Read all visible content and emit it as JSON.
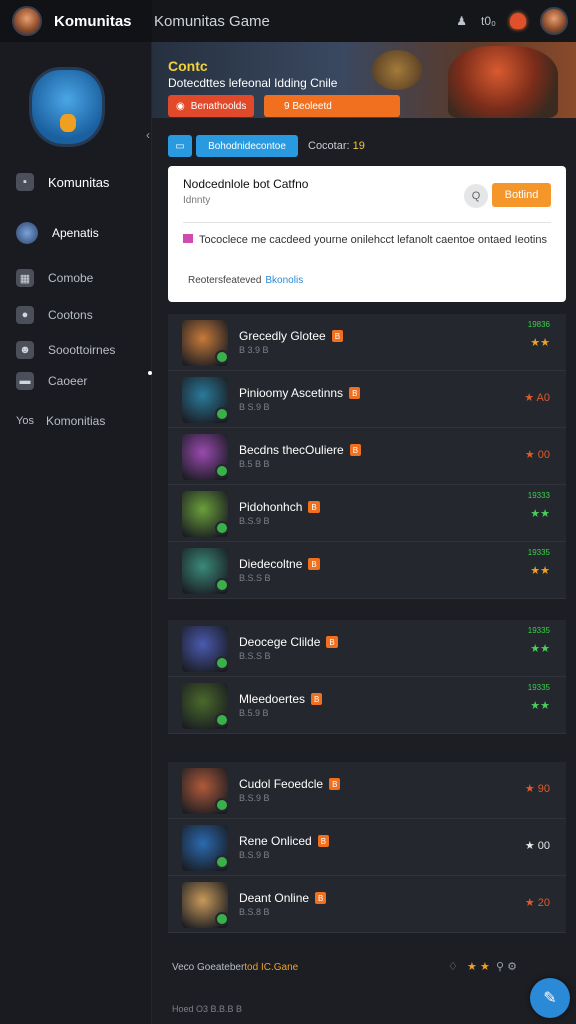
{
  "sidebar": {
    "brand": "Komunitas",
    "items": [
      {
        "label": "Komunitas",
        "icon": "square-icon"
      },
      {
        "label": "Apenatis",
        "icon": "avatar"
      },
      {
        "label": "Comobe",
        "icon": "grid-icon"
      },
      {
        "label": "Cootons",
        "icon": "gamepad-icon"
      },
      {
        "label": "Sooottoirnes",
        "icon": "people-icon"
      },
      {
        "label": "Caoeer",
        "icon": "chat-icon"
      },
      {
        "label": "Komonitias",
        "prefix": "Yos"
      }
    ]
  },
  "header": {
    "title": "Komunitas Game",
    "counter": "t0₀",
    "icon_left": "♟"
  },
  "banner": {
    "title": "Contc",
    "subtitle": "Dotecdttes lefeonal Idding Cnile",
    "button1": "Benathoolds",
    "button2": "9 Beoleetd"
  },
  "chips": {
    "icon_tab": "▭",
    "tab": "Bohodnidecontoe",
    "count_label": "Cocotar:",
    "count_value": "19"
  },
  "post": {
    "title": "Nodcednlole bot Catfno",
    "subtitle": "Idnnty",
    "game_btn": "Q",
    "action_btn": "Botlind",
    "message": "Tococlece me cacdeed yourne onilehcct lefanolt caentoe ontaed Ieotins",
    "footer": "Reotersfeateved",
    "footer_link": "Bkonolis"
  },
  "games": [
    {
      "name": "Grecedly Glotee",
      "badge": "B",
      "sub": "B 3.9 B",
      "count": "19836",
      "rating": "★★",
      "rating_style": "o",
      "thumb": "#c87a3a"
    },
    {
      "name": "Pinioomy Ascetinns",
      "badge": "B",
      "sub": "B S.9 B",
      "count": "",
      "rating": "★ A0",
      "rating_style": "r",
      "thumb": "#2a7a9a"
    },
    {
      "name": "Becdns thecOuliere",
      "badge": "B",
      "sub": "B.5 B B",
      "count": "",
      "rating": "★ 00",
      "rating_style": "r",
      "thumb": "#9a4ab0"
    },
    {
      "name": "Pidohonhch",
      "badge": "B",
      "sub": "B.S.9 B",
      "count": "19333",
      "rating": "★★",
      "rating_style": "g",
      "thumb": "#6aa03a"
    },
    {
      "name": "Diedecoltne",
      "badge": "B",
      "sub": "B.S.S B",
      "count": "19335",
      "rating": "★★",
      "rating_style": "o",
      "thumb": "#3a8a7a"
    },
    {
      "name": "Deocege Clilde",
      "badge": "B",
      "sub": "B.S.S B",
      "count": "19335",
      "rating": "★★",
      "rating_style": "g",
      "thumb": "#4a5ab0"
    },
    {
      "name": "Mleedoertes",
      "badge": "B",
      "sub": "B.5.9 B",
      "count": "19335",
      "rating": "★★",
      "rating_style": "g",
      "thumb": "#4a6a2a"
    },
    {
      "name": "Cudol Feoedcle",
      "badge": "B",
      "sub": "B.S.9 B",
      "count": "",
      "rating": "★ 90",
      "rating_style": "r",
      "thumb": "#b05a3a"
    },
    {
      "name": "Rene Onliced",
      "badge": "B",
      "sub": "B.S.9 B",
      "count": "",
      "rating": "★ 00",
      "rating_style": "w",
      "thumb": "#2a6ab0"
    },
    {
      "name": "Deant Online",
      "badge": "B",
      "sub": "B.S.8 B",
      "count": "",
      "rating": "★ 20",
      "rating_style": "r",
      "thumb": "#c89a5a"
    }
  ],
  "footer": {
    "text": "Veco Goeateber",
    "highlight": "tod IC.Gane",
    "copyright": "Hoed O3 B.B.B B"
  }
}
